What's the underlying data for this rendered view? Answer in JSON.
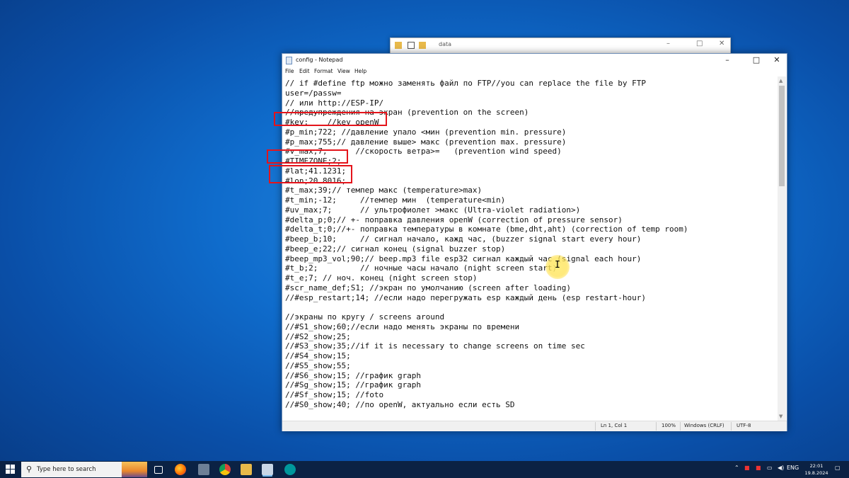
{
  "explorer": {
    "title": "data"
  },
  "notepad": {
    "title": "config - Notepad",
    "controls": {
      "minimize": "–",
      "maximize": "□",
      "close": "✕"
    },
    "menu": [
      "File",
      "Edit",
      "Format",
      "View",
      "Help"
    ],
    "lines": [
      "// if #define ftp можно заменять файл по FTP//you can replace the file by FTP",
      "user=/passw=",
      "// или http://ESP-IP/",
      "//предупреждения на экран (prevention on the screen)",
      "#key;    //key openW",
      "#p_min;722; //давление упало <мин (prevention min. pressure)",
      "#p_max;755;// давление выше> макс (prevention max. pressure)",
      "#v_max;7;      //скорость ветра>=   (prevention wind speed)",
      "#TIMEZONE;2;",
      "#lat;41.1231;",
      "#lon;20.8016;",
      "#t_max;39;// темпер макс (temperature>max)",
      "#t_min;-12;     //темпер мин  (temperature<min)",
      "#uv_max;7;      // ультрофиолет >макс (Ultra-violet radiation>)",
      "#delta_p;0;// +- поправка давления openW (correction of pressure sensor)",
      "#delta_t;0;//+- поправка температуры в комнате (bme,dht,aht) (correction of temp room)",
      "#beep_b;10;     // сигнал начало, кажд час, (buzzer signal start every hour)",
      "#beep_e;22;// сигнал конец (signal buzzer stop)",
      "#beep_mp3_vol;90;// beep.mp3 file esp32 сигнал каждый час (signal each hour)",
      "#t_b;2;         // ночные часы начало (night screen start)",
      "#t_e;7; // ноч. конец (night screen stop)",
      "#scr_name_def;S1; //экран по умолчанию (screen after loading)",
      "//#esp_restart;14; //если надо перегружать esp каждый день (esp restart-hour)",
      "",
      "//экраны по кругу / screens around",
      "//#S1_show;60;//если надо менять экраны по времени",
      "//#S2_show;25;",
      "//#S3_show;35;//if it is necessary to change screens on time sec",
      "//#S4_show;15;",
      "//#S5_show;55;",
      "//#S6_show;15; //график graph",
      "//#Sg_show;15; //график graph",
      "//#Sf_show;15; //foto",
      "//#S0_show;40; //по openW, актуально если есть SD"
    ],
    "status": {
      "position": "Ln 1, Col 1",
      "zoom": "100%",
      "line_ending": "Windows (CRLF)",
      "encoding": "UTF-8"
    }
  },
  "taskbar": {
    "search_placeholder": "Type here to search",
    "language": "ENG",
    "time": "22:01",
    "date": "19.8.2024"
  },
  "colors": {
    "highlight_box": "#e4141b",
    "taskbar": "#0b2244",
    "desktop": "#0f6ccc"
  }
}
